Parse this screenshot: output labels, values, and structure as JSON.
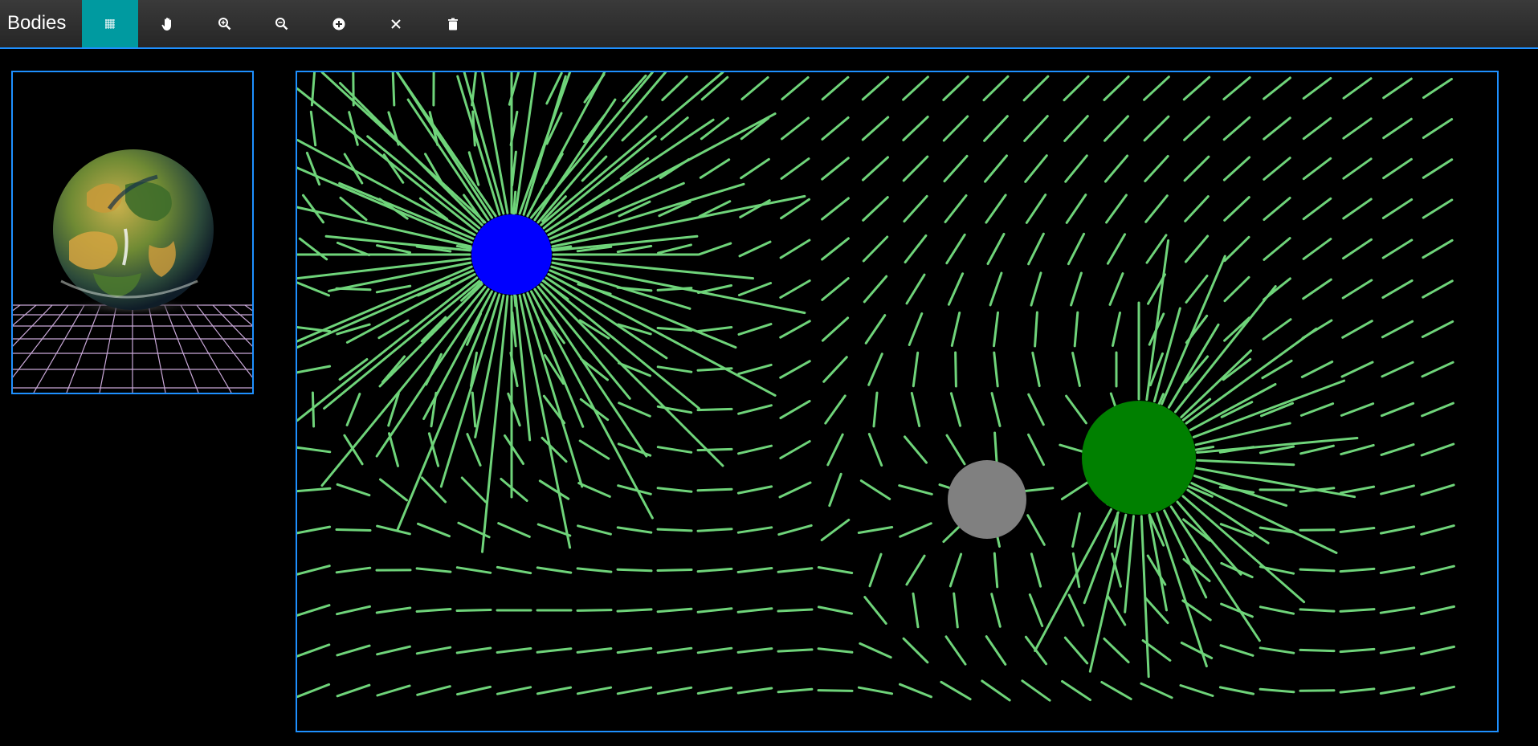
{
  "app": {
    "title": "Bodies"
  },
  "toolbar": {
    "tools": [
      {
        "name": "grid-tool-button",
        "icon": "grid-icon",
        "active": true
      },
      {
        "name": "pan-tool-button",
        "icon": "hand-icon",
        "active": false
      },
      {
        "name": "zoom-in-button",
        "icon": "zoom-in-icon",
        "active": false
      },
      {
        "name": "zoom-out-button",
        "icon": "zoom-out-icon",
        "active": false
      },
      {
        "name": "add-body-button",
        "icon": "add-circle-icon",
        "active": false
      },
      {
        "name": "clear-button",
        "icon": "close-icon",
        "active": false
      },
      {
        "name": "delete-button",
        "icon": "trash-icon",
        "active": false
      }
    ]
  },
  "preview": {
    "subject": "planet-over-grid"
  },
  "field": {
    "line_color": "#6fd47a",
    "bodies": [
      {
        "name": "blue-body",
        "color": "#0000ff"
      },
      {
        "name": "gray-body",
        "color": "#808080"
      },
      {
        "name": "green-body",
        "color": "#008000"
      }
    ]
  }
}
